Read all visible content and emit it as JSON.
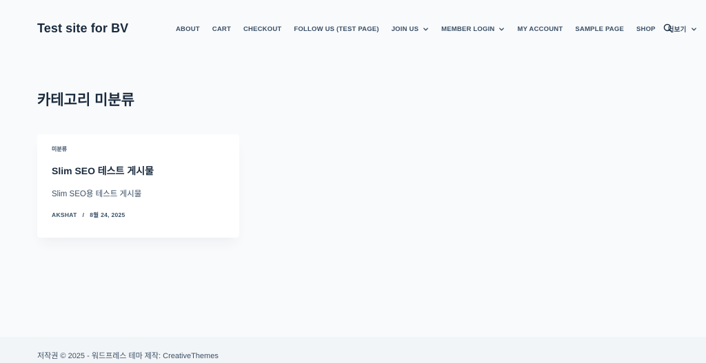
{
  "header": {
    "site_title": "Test site for BV",
    "nav": [
      {
        "label": "ABOUT",
        "has_dropdown": false
      },
      {
        "label": "CART",
        "has_dropdown": false
      },
      {
        "label": "CHECKOUT",
        "has_dropdown": false
      },
      {
        "label": "FOLLOW US (TEST PAGE)",
        "has_dropdown": false
      },
      {
        "label": "JOIN US",
        "has_dropdown": true
      },
      {
        "label": "MEMBER LOGIN",
        "has_dropdown": true
      },
      {
        "label": "MY ACCOUNT",
        "has_dropdown": false
      },
      {
        "label": "SAMPLE PAGE",
        "has_dropdown": false
      },
      {
        "label": "SHOP",
        "has_dropdown": false
      },
      {
        "label": "더보기",
        "has_dropdown": true
      }
    ],
    "search_icon": "search-icon"
  },
  "main": {
    "page_title": "카테고리 미분류",
    "posts": [
      {
        "category": "미분류",
        "title": "Slim SEO 테스트 게시물",
        "excerpt": "Slim SEO용 테스트 게시물",
        "author": "AKSHAT",
        "separator": "/",
        "date": "8월 24, 2025"
      }
    ]
  },
  "footer": {
    "text": "저작권 © 2025 - 워드프레스 테마 제작: CreativeThemes"
  },
  "colors": {
    "background": "#f9fafb",
    "heading": "#192a3d",
    "text": "#3a4f66",
    "card": "#ffffff",
    "footer_bg": "#f2f5f7"
  }
}
